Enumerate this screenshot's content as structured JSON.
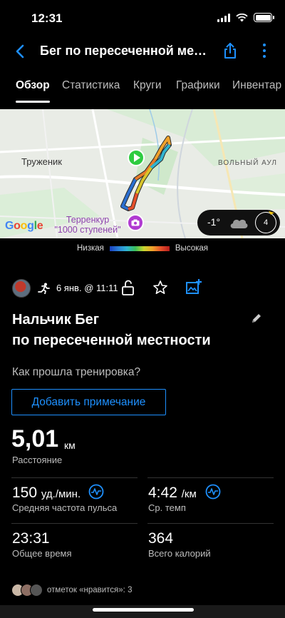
{
  "status_bar": {
    "time": "12:31"
  },
  "header": {
    "title": "Бег по пересеченной мес..."
  },
  "tabs": [
    {
      "label": "Обзор"
    },
    {
      "label": "Статистика"
    },
    {
      "label": "Круги"
    },
    {
      "label": "Графики"
    },
    {
      "label": "Инвентар"
    }
  ],
  "map": {
    "labels": {
      "town": "Труженик",
      "village": "ВОЛЬНЫЙ АУЛ",
      "poi_line1": "Терренкур",
      "poi_line2": "\"1000 ступеней\""
    },
    "attribution": "Google",
    "weather": {
      "temperature": "-1°",
      "wind_speed": "4"
    }
  },
  "legend": {
    "low": "Низкая",
    "high": "Высокая"
  },
  "activity": {
    "date": "6 янв. @ 11:11",
    "title_line1": "Нальчик Бег",
    "title_line2": "по пересеченной местности",
    "question": "Как прошла тренировка?",
    "add_note": "Добавить примечание"
  },
  "stats": {
    "distance": {
      "value": "5,01",
      "unit": "км",
      "label": "Расстояние"
    },
    "heart_rate": {
      "value": "150",
      "unit": "уд./мин.",
      "label": "Средняя частота пульса"
    },
    "pace": {
      "value": "4:42",
      "unit": "/км",
      "label": "Ср. темп"
    },
    "total_time": {
      "value": "23:31",
      "label": "Общее время"
    },
    "calories": {
      "value": "364",
      "label": "Всего калорий"
    }
  },
  "likes": {
    "text": "отметок «нравится»: 3"
  },
  "colors": {
    "accent": "#1e90ff",
    "background": "#000000",
    "secondary_text": "#bdbdbd"
  }
}
